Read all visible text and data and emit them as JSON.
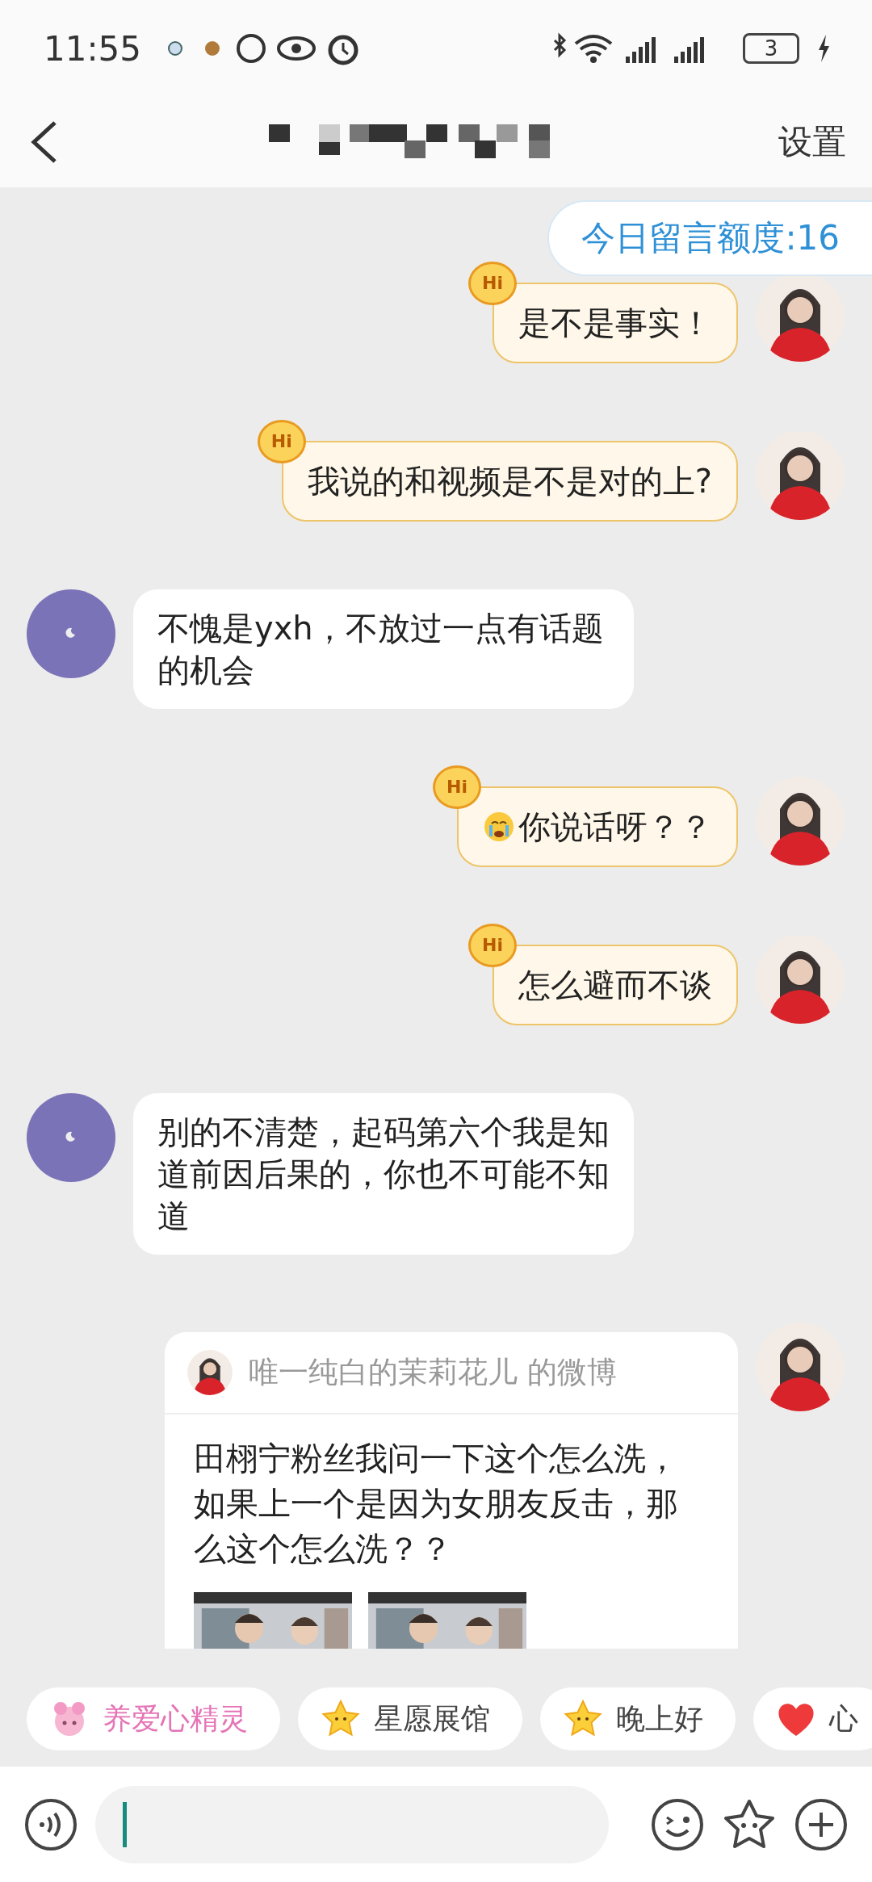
{
  "status_bar": {
    "time": "11:55",
    "battery": "3"
  },
  "header": {
    "action": "设置"
  },
  "quota": "今日留言额度:16",
  "messages": [
    {
      "kind": "outgoing",
      "badge": "Hi",
      "emoji": false,
      "text": "是不是事实！"
    },
    {
      "kind": "outgoing",
      "badge": "Hi",
      "emoji": false,
      "text": "我说的和视频是不是对的上?"
    },
    {
      "kind": "incoming",
      "emoji": false,
      "text": "不愧是yxh，不放过一点有话题的机会"
    },
    {
      "kind": "outgoing",
      "badge": "Hi",
      "emoji": true,
      "text": "你说话呀？？"
    },
    {
      "kind": "outgoing",
      "badge": "Hi",
      "emoji": false,
      "text": "怎么避而不谈"
    },
    {
      "kind": "incoming",
      "emoji": false,
      "text": "别的不清楚，起码第六个我是知道前因后果的，你也不可能不知道"
    },
    {
      "kind": "share",
      "source": "唯一纯白的茉莉花儿 的微博",
      "text": "田栩宁粉丝我问一下这个怎么洗，如果上一个是因为女朋友反击，那么这个怎么洗？？"
    }
  ],
  "chips": [
    {
      "kind": "sprite",
      "label": "养爱心精灵",
      "highlight": true
    },
    {
      "kind": "star",
      "label": "星愿展馆",
      "highlight": false
    },
    {
      "kind": "star",
      "label": "晚上好",
      "highlight": false
    },
    {
      "kind": "heart",
      "label": "心",
      "highlight": false
    }
  ]
}
